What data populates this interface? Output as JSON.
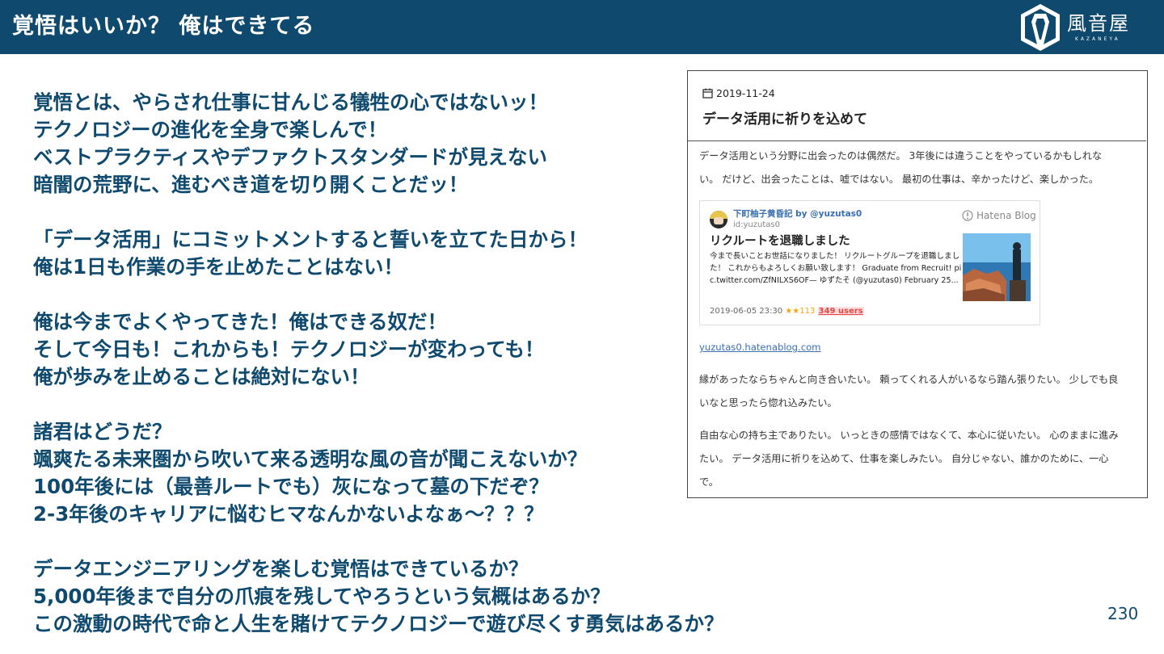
{
  "header": {
    "title": "覚悟はいいか？ 俺はできてる",
    "logo_name": "風音屋",
    "logo_sub": "KAZANEYA"
  },
  "body_lines": [
    "覚悟とは、やらされ仕事に甘んじる犠牲の心ではないッ！",
    "テクノロジーの進化を全身で楽しんで！",
    "ベストプラクティスやデファクトスタンダードが見えない",
    "暗闇の荒野に、進むべき道を切り開くことだッ！",
    "",
    "「データ活用」にコミットメントすると誓いを立てた日から！",
    "俺は1日も作業の手を止めたことはない！",
    "",
    "俺は今までよくやってきた！俺はできる奴だ！",
    "そして今日も！これからも！テクノロジーが変わっても！",
    "俺が歩みを止めることは絶対にない！",
    "",
    "諸君はどうだ？",
    "颯爽たる未来圏から吹いて来る透明な風の音が聞こえないか？",
    "100年後には（最善ルートでも）灰になって墓の下だぞ？",
    "2-3年後のキャリアに悩むヒマなんかないよなぁ〜？？？",
    "",
    "データエンジニアリングを楽しむ覚悟はできているか？",
    "5,000年後まで自分の爪痕を残してやろうという気概はあるか？",
    "この激動の時代で命と人生を賭けてテクノロジーで遊び尽くす勇気はあるか？"
  ],
  "page_number": "230",
  "blog": {
    "date": "2019-11-24",
    "title": "データ活用に祈りを込めて",
    "para1": [
      "データ活用という分野に出会ったのは偶然だ。 3年後には違うことをやっているかもしれな",
      "い。 だけど、出会ったことは、嘘ではない。 最初の仕事は、辛かったけど、楽しかった。"
    ],
    "embed": {
      "author": "下町柚子黄昏記 by @yuzutas0",
      "id": "id:yuzutas0",
      "brand": "Hatena Blog",
      "title": "リクルートを退職しました",
      "text": [
        "今まで長いことお世話になりました！ リクルートグループを退職しまし",
        "た！ これからもよろしくお願い致します！ Graduate from Recruit! pi",
        "c.twitter.com/ZfNILXS6OF— ゆずたそ (@yuzutas0) February 25..."
      ],
      "datetime": "2019-06-05 23:30",
      "stars": "★★113",
      "users": "349 users"
    },
    "link": "yuzutas0.hatenablog.com",
    "para2": [
      "縁があったならちゃんと向き合いたい。 頼ってくれる人がいるなら踏ん張りたい。 少しでも良",
      "いなと思ったら惚れ込みたい。"
    ],
    "para3": [
      "自由な心の持ち主でありたい。 いっときの感情ではなくて、本心に従いたい。 心のままに進み",
      "たい。 データ活用に祈りを込めて、仕事を楽しみたい。 自分じゃない、誰かのために、一心",
      "で。"
    ]
  },
  "colors": {
    "brand_navy": "#0f4a6e",
    "link_blue": "#3a6fb0",
    "star_orange": "#f2a712",
    "users_red": "#e84444"
  },
  "icons": {
    "logo": "kazaneya-shield-logo",
    "calendar": "calendar-icon",
    "hatena": "hatena-blog-icon"
  }
}
